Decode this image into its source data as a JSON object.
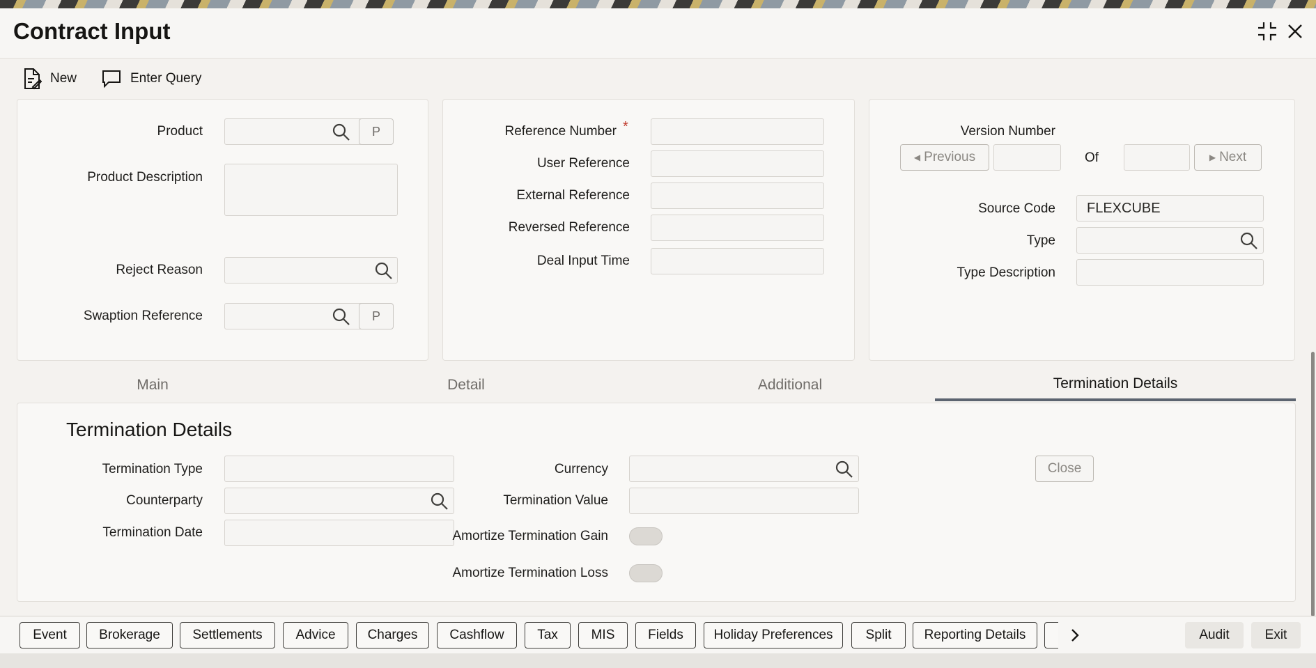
{
  "window": {
    "title": "Contract Input"
  },
  "toolbar": {
    "new_label": "New",
    "enter_query_label": "Enter Query"
  },
  "left_panel": {
    "product_label": "Product",
    "product_value": "",
    "product_p_button": "P",
    "product_description_label": "Product Description",
    "product_description_value": "",
    "reject_reason_label": "Reject Reason",
    "reject_reason_value": "",
    "swaption_reference_label": "Swaption Reference",
    "swaption_reference_value": "",
    "swaption_p_button": "P"
  },
  "middle_panel": {
    "reference_number_label": "Reference Number",
    "required_marker": "*",
    "reference_number_value": "",
    "user_reference_label": "User Reference",
    "user_reference_value": "",
    "external_reference_label": "External Reference",
    "external_reference_value": "",
    "reversed_reference_label": "Reversed Reference",
    "reversed_reference_value": "",
    "deal_input_time_label": "Deal Input Time",
    "deal_input_time_value": ""
  },
  "right_panel": {
    "version_number_label": "Version Number",
    "previous_label": "Previous",
    "version_current": "",
    "of_label": "Of",
    "version_total": "",
    "next_label": "Next",
    "source_code_label": "Source Code",
    "source_code_value": "FLEXCUBE",
    "type_label": "Type",
    "type_value": "",
    "type_description_label": "Type Description",
    "type_description_value": ""
  },
  "tabs": [
    {
      "label": "Main",
      "active": false
    },
    {
      "label": "Detail",
      "active": false
    },
    {
      "label": "Additional",
      "active": false
    },
    {
      "label": "Termination Details",
      "active": true
    }
  ],
  "termination": {
    "section_title": "Termination Details",
    "termination_type_label": "Termination Type",
    "termination_type_value": "",
    "counterparty_label": "Counterparty",
    "counterparty_value": "",
    "termination_date_label": "Termination Date",
    "termination_date_value": "",
    "currency_label": "Currency",
    "currency_value": "",
    "termination_value_label": "Termination Value",
    "termination_value_value": "",
    "amortize_gain_label": "Amortize Termination Gain",
    "amortize_gain_on": false,
    "amortize_loss_label": "Amortize Termination Loss",
    "amortize_loss_on": false,
    "close_label": "Close"
  },
  "footer": {
    "buttons": [
      "Event",
      "Brokerage",
      "Settlements",
      "Advice",
      "Charges",
      "Cashflow",
      "Tax",
      "MIS",
      "Fields",
      "Holiday Preferences",
      "Split",
      "Reporting Details"
    ],
    "audit_label": "Audit",
    "exit_label": "Exit"
  },
  "colors": {
    "accent_tab_underline": "#5c6470",
    "required": "#c0392b"
  }
}
